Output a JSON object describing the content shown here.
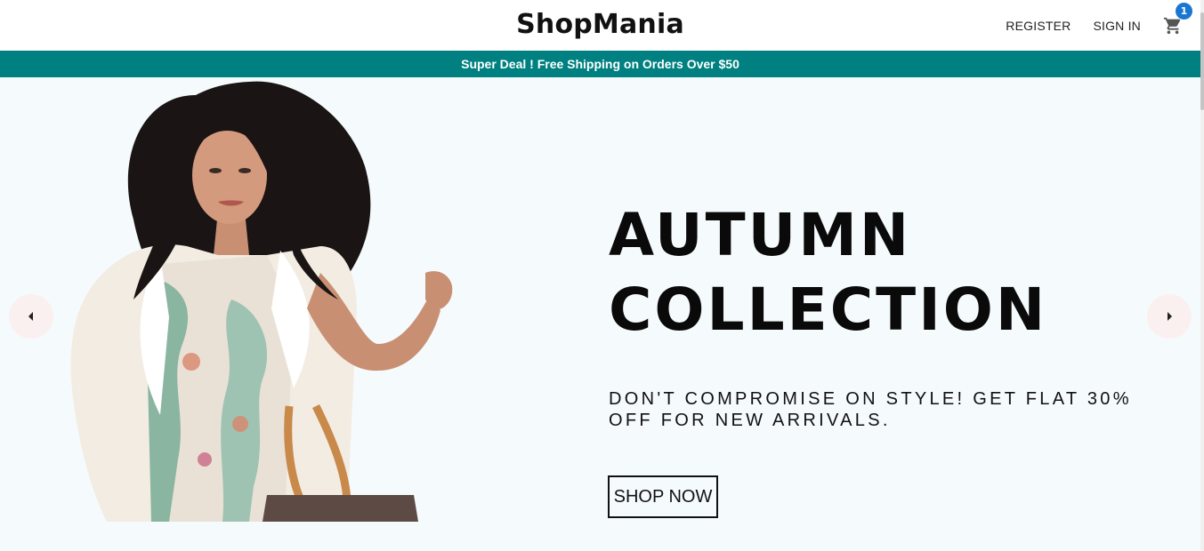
{
  "brand": {
    "name": "ShopMania"
  },
  "nav": {
    "register_label": "REGISTER",
    "signin_label": "SIGN IN",
    "cart_count": "1",
    "cart_icon": "shopping-cart-icon"
  },
  "announcement": {
    "text": "Super Deal ! Free Shipping on Orders Over $50"
  },
  "slider": {
    "title_line1": "AUTUMN",
    "title_line2": "COLLECTION",
    "description": "DON'T COMPROMISE ON STYLE! GET FLAT 30% OFF FOR NEW ARRIVALS.",
    "button_label": "SHOP NOW",
    "prev_icon": "arrow-left-icon",
    "next_icon": "arrow-right-icon"
  },
  "colors": {
    "accent_teal": "#008080",
    "badge_blue": "#1976d2",
    "hero_bg": "#f5fafd",
    "arrow_bg": "#fbf0f0"
  }
}
